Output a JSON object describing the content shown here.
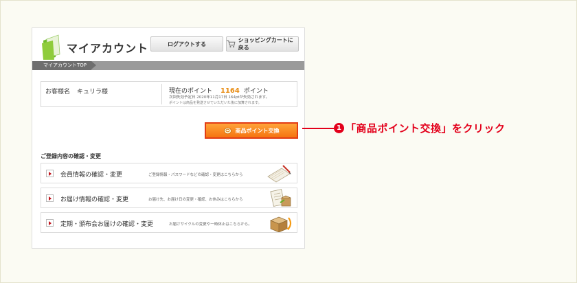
{
  "header": {
    "title": "マイアカウント",
    "logout_label": "ログアウトする",
    "cart_label": "ショッピングカートに戻る"
  },
  "breadcrumb": {
    "current": "マイアカウントTOP"
  },
  "account": {
    "customer_label": "お客様名",
    "customer_name": "キュリラ様",
    "points_label": "現在のポイント",
    "points_value": "1164",
    "points_unit": "ポイント",
    "expiry_note": "次回失効予定日 2020年11月17日 164ptが失効されます。",
    "points_note": "ポイントは商品を発送させていただいた後に加算されます。"
  },
  "exchange_button": {
    "label": "商品ポイント交換"
  },
  "section": {
    "title": "ご登録内容の確認・変更",
    "items": [
      {
        "label": "会員情報の確認・変更",
        "description": "ご登録情報・パスワードなどの確認・変更はこちらから"
      },
      {
        "label": "お届け情報の確認・変更",
        "description": "お届け先、お届け日の変更・確認、お休みはこちらから"
      },
      {
        "label": "定期・頒布会お届けの確認・変更",
        "description": "お届けサイクルの変更や一時休止はこちらから。"
      }
    ]
  },
  "annotation": {
    "number": "1",
    "text": "「商品ポイント交換」をクリック"
  },
  "colors": {
    "accent_orange": "#f57410",
    "annotation_red": "#e3001b",
    "points_orange": "#e88a0e"
  }
}
